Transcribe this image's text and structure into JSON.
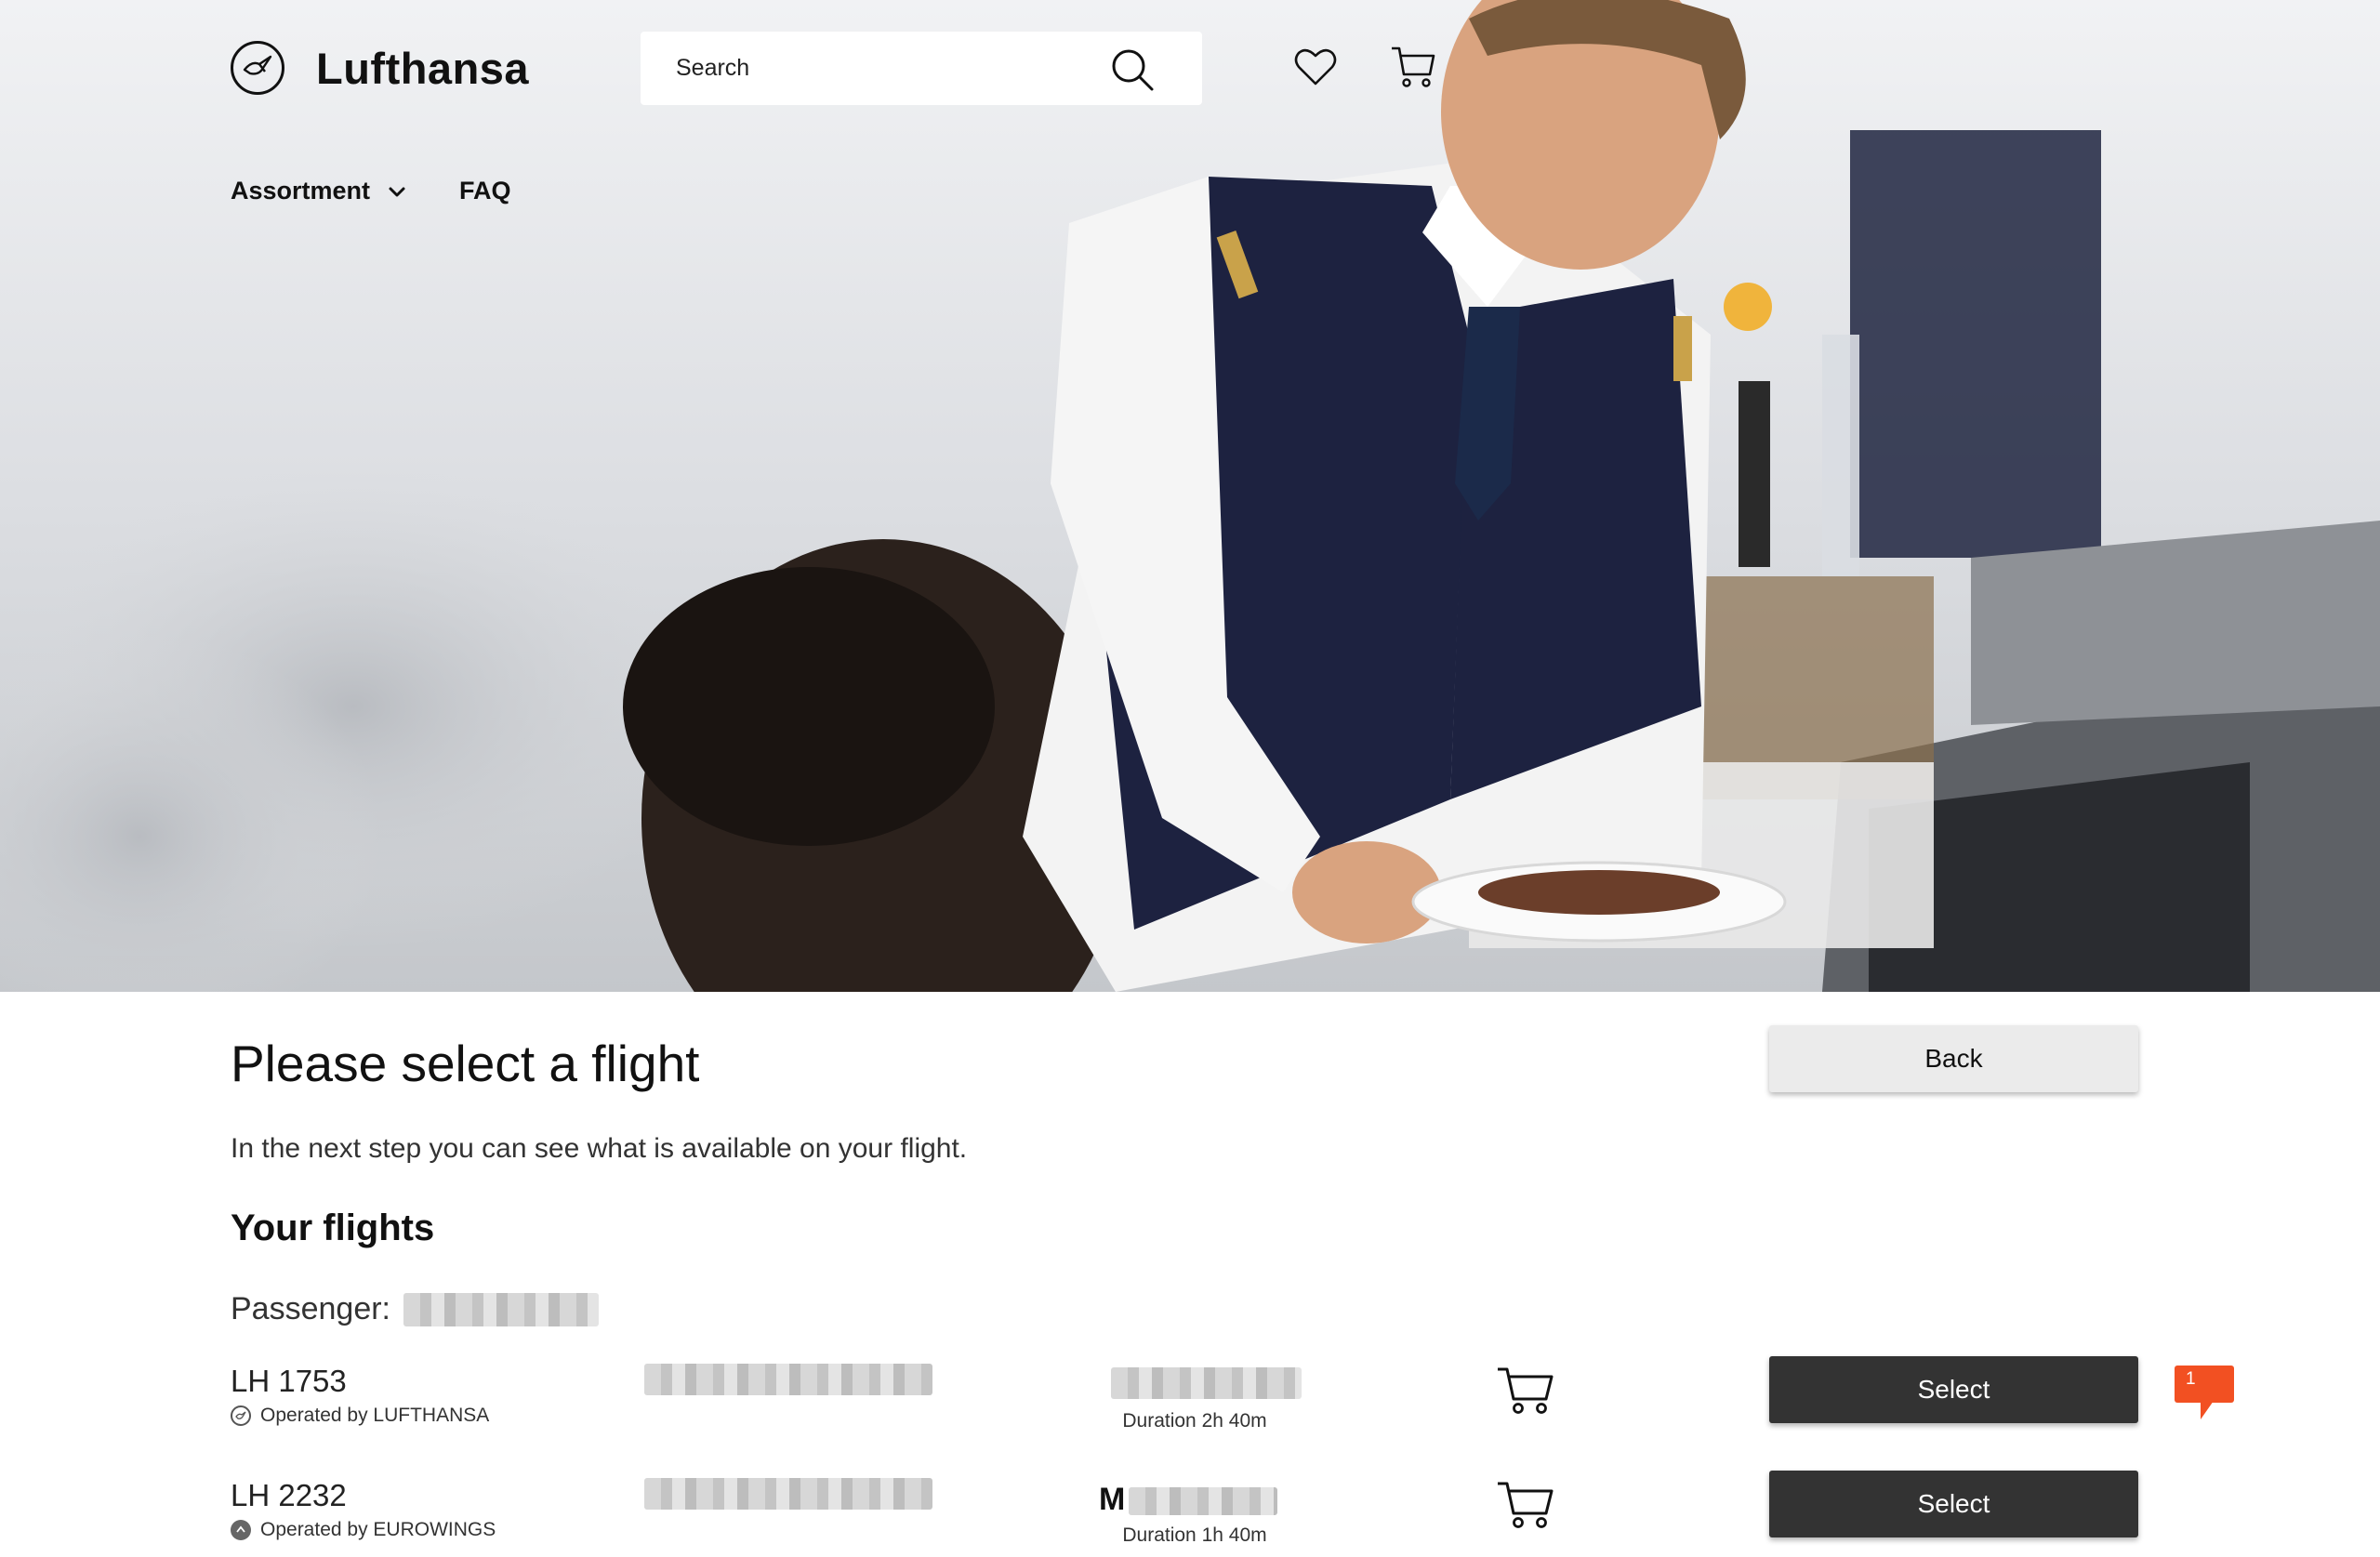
{
  "header": {
    "brand": "Lufthansa",
    "search_placeholder": "Search",
    "icons": [
      "lufthansa-crane-logo",
      "search-icon",
      "heart-icon",
      "cart-icon"
    ]
  },
  "nav": {
    "items": [
      {
        "label": "Assortment",
        "has_dropdown": true
      },
      {
        "label": "FAQ",
        "has_dropdown": false
      }
    ]
  },
  "main": {
    "title": "Please select a flight",
    "subtitle": "In the next step you can see what is available on your flight.",
    "back_label": "Back",
    "section_title": "Your flights",
    "passenger_label": "Passenger:",
    "flights": [
      {
        "number": "LH 1753",
        "operated_by": "Operated by LUFTHANSA",
        "duration": "Duration 2h 40m",
        "select_label": "Select",
        "notification_count": "1"
      },
      {
        "number": "LH 2232",
        "operated_by": "Operated by EUROWINGS",
        "route_prefix": "M",
        "duration": "Duration 1h 40m",
        "select_label": "Select"
      }
    ]
  },
  "colors": {
    "primary_button": "#333333",
    "secondary_button": "#ebebeb",
    "badge": "#f25022",
    "text": "#111111"
  }
}
